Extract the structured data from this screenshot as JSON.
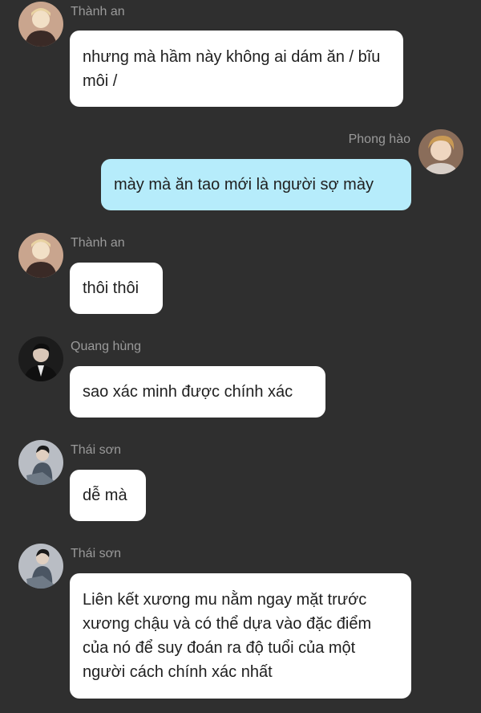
{
  "messages": [
    {
      "sender": "Thành an",
      "direction": "in",
      "avatar": "avatar-thanh-an",
      "text": "nhưng mà hầm này không ai dám ăn / bĩu môi /"
    },
    {
      "sender": "Phong hào",
      "direction": "out",
      "avatar": "avatar-phong-hao",
      "text": "mày mà ăn tao mới là người sợ mày"
    },
    {
      "sender": "Thành an",
      "direction": "in",
      "avatar": "avatar-thanh-an",
      "text": "thôi thôi"
    },
    {
      "sender": "Quang hùng",
      "direction": "in",
      "avatar": "avatar-quang-hung",
      "text": "sao xác minh được chính xác"
    },
    {
      "sender": "Thái sơn",
      "direction": "in",
      "avatar": "avatar-thai-son",
      "text": "dễ mà"
    },
    {
      "sender": "Thái sơn",
      "direction": "in",
      "avatar": "avatar-thai-son",
      "text": "Liên kết xương mu nằm ngay mặt trước xương chậu và có thể dựa vào đặc điểm của nó để suy đoán ra độ tuổi của một người cách chính xác nhất"
    }
  ],
  "colors": {
    "background": "#2f2f2f",
    "incoming_bubble": "#ffffff",
    "outgoing_bubble": "#b6ecfb",
    "sender_name": "#9a9a9a"
  }
}
